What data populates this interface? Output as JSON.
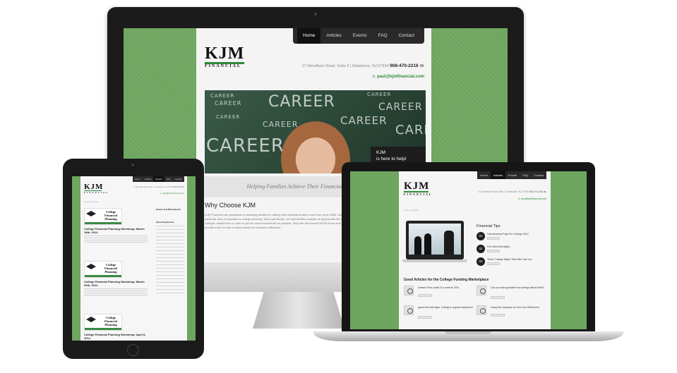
{
  "brand": {
    "logo_mark": "KJM",
    "logo_sub": "FINANCIAL",
    "accent_color": "#2e8a3c",
    "bg_green": "#6ea55f"
  },
  "imac": {
    "nav": [
      "Home",
      "Articles",
      "Events",
      "FAQ",
      "Contact"
    ],
    "address": "17 Mendham Road, Suite 2 | Gladstone, NJ 07934",
    "phone": "908-470-2216",
    "email_label": "e:",
    "email": "paul@kjmfinancial.com",
    "hero_words": [
      "CAREER",
      "CAREER",
      "CAREER",
      "CAREER",
      "CAREER",
      "CAREER",
      "CAREER",
      "CAREER",
      "CAREER",
      "CAREER"
    ],
    "hero_box_line1": "KJM",
    "hero_box_line2": "is here to help!",
    "tagline": "Helping Families Achieve Their Financial Goals Since 1986",
    "section_title": "Why Choose KJM",
    "section_text": "KJM Financial has specialized in assisting families in making their financial dreams come true since 1986. Our particular area of expertise is college planning. More specifically, we help families compile an appropriate list of colleges, assist them in order to get as much financial aid as possible, help with the annual FAFSA forms and provide tools in order to invest wisely for maximum efficiency."
  },
  "ipad": {
    "nav": [
      "Home",
      "Articles",
      "Events",
      "FAQ",
      "Contact"
    ],
    "address": "17 Mendham Road, Suite 2 | Gladstone, NJ 07934",
    "phone": "908-470-2216",
    "email": "e: paul@kjmfinancial.com",
    "breadcrumb": "Home » Events",
    "thumb_title": "College Financial Planning",
    "posts": [
      "College Financial Planning Workshop: March 18th, 2014",
      "College Financial Planning Workshop: March 26th, 2014",
      "College Financial Planning Workshop: April 8, 2014"
    ],
    "side_heading": "Events at KJM Financial",
    "side_sub": "Upcoming Events"
  },
  "macbook": {
    "nav": [
      "Home",
      "Articles",
      "Events",
      "FAQ",
      "Contact"
    ],
    "address": "17 Mendham Road, Suite 2 | Gladstone, NJ 07934",
    "phone": "908-470-2216",
    "email": "e: paul@kjmfinancial.com",
    "breadcrumb": "Home » Articles",
    "tips_heading": "Financial Tips",
    "tips": [
      {
        "num": "01",
        "text": "How America Pays For College 2012"
      },
      {
        "num": "02",
        "text": "Five Merit Aid Myths"
      },
      {
        "num": "03",
        "text": "Three College Myths That Will Cost You"
      }
    ],
    "good_heading": "Good Articles for the College Funding Marketplace",
    "articles": [
      "Investor Fear Leads To Losses in 2011",
      "Can your kids graduate from college without debt?",
      "Ignore the debt hype, College is a great investment!",
      "Using Life Insurance to Fund Your Retirement"
    ]
  }
}
